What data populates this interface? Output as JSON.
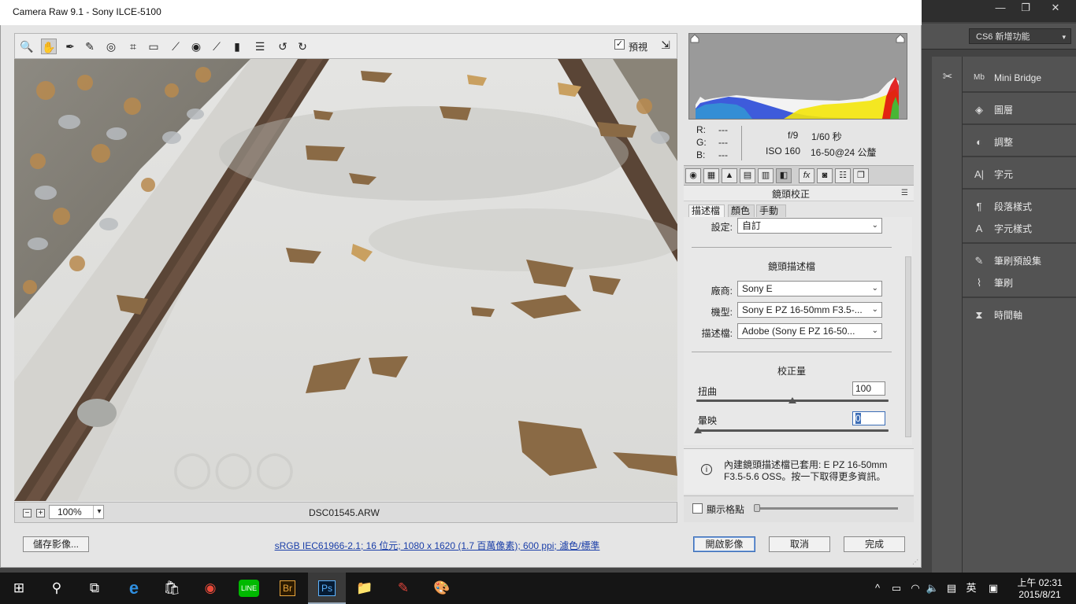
{
  "window": {
    "title": "Camera Raw 9.1  -  Sony ILCE-5100"
  },
  "photoshop": {
    "workspace": "CS6 新增功能",
    "window_controls": [
      "—",
      "❐",
      "✕"
    ],
    "panels": [
      {
        "icon": "Mb",
        "label": "Mini Bridge"
      },
      {
        "icon": "◈",
        "label": "圖層"
      },
      {
        "icon": "◐",
        "label": "調整"
      },
      {
        "icon": "A|",
        "label": "字元"
      },
      {
        "icon": "¶",
        "label": "段落樣式"
      },
      {
        "icon": "A",
        "label": "字元樣式"
      },
      {
        "icon": "✎",
        "label": "筆刷預設集"
      },
      {
        "icon": "⌇",
        "label": "筆刷"
      },
      {
        "icon": "⧗",
        "label": "時間軸"
      }
    ]
  },
  "toolbar": {
    "tools": [
      {
        "name": "zoom-tool",
        "glyph": "🔍"
      },
      {
        "name": "hand-tool",
        "glyph": "✋"
      },
      {
        "name": "white-balance-tool",
        "glyph": "✒"
      },
      {
        "name": "color-sampler-tool",
        "glyph": "✎"
      },
      {
        "name": "targeted-adjustment-tool",
        "glyph": "◎"
      },
      {
        "name": "crop-tool",
        "glyph": "⌗"
      },
      {
        "name": "straighten-tool",
        "glyph": "▭"
      },
      {
        "name": "spot-removal-tool",
        "glyph": "⟋"
      },
      {
        "name": "red-eye-tool",
        "glyph": "◉"
      },
      {
        "name": "adjustment-brush",
        "glyph": "⟋"
      },
      {
        "name": "graduated-filter",
        "glyph": "▮"
      },
      {
        "name": "preferences",
        "glyph": "☰"
      },
      {
        "name": "rotate-left",
        "glyph": "↺"
      },
      {
        "name": "rotate-right",
        "glyph": "↻"
      }
    ],
    "preview_label": "預視",
    "preview_checked": "✓"
  },
  "statusbar": {
    "zoom_minus": "−",
    "zoom_plus": "+",
    "zoom": "100%",
    "filename": "DSC01545.ARW"
  },
  "info": {
    "r_label": "R:",
    "r_val": "---",
    "g_label": "G:",
    "g_val": "---",
    "b_label": "B:",
    "b_val": "---",
    "aperture": "f/9",
    "shutter": "1/60 秒",
    "iso": "ISO 160",
    "lens": "16-50@24 公釐"
  },
  "panel_tabs": [
    "◉",
    "▦",
    "▲",
    "▤",
    "▥",
    "◧",
    "fx",
    "◙",
    "☷",
    "❒"
  ],
  "lens_panel": {
    "title": "鏡頭校正",
    "menu": "☰",
    "subtabs": [
      "描述檔",
      "顏色",
      "手動"
    ],
    "setting_label": "設定:",
    "setting_value": "自訂",
    "profile_section": "鏡頭描述檔",
    "make_label": "廠商:",
    "make_value": "Sony E",
    "model_label": "機型:",
    "model_value": "Sony E PZ 16-50mm F3.5-...",
    "profile_label": "描述檔:",
    "profile_value": "Adobe (Sony E PZ 16-50...",
    "amount_section": "校正量",
    "distortion_label": "扭曲",
    "distortion_value": "100",
    "vignetting_label": "暈映",
    "vignetting_value": "0",
    "info_text": "內建鏡頭描述檔已套用: E PZ 16-50mm F3.5-5.6 OSS。按一下取得更多資訊。",
    "grid_label": "顯示格點"
  },
  "sliders": {
    "distortion": 0.5,
    "vignetting": 0.0
  },
  "bottom": {
    "save_label": "儲存影像...",
    "workflow": "sRGB IEC61966-2.1; 16 位元; 1080 x 1620 (1.7 百萬像素); 600 ppi; 濾色/標準",
    "open_label": "開啟影像",
    "cancel_label": "取消",
    "done_label": "完成"
  },
  "taskbar": {
    "apps": [
      "⊞",
      "⚲",
      "⧉",
      "e",
      "🛍",
      "◉",
      "LINE",
      "Br",
      "Ps",
      "📁",
      "✎",
      "🎨"
    ],
    "tray": [
      "^",
      "▭",
      "◠",
      "🔈",
      "▤",
      "英",
      "▣"
    ],
    "time": "上午 02:31",
    "date": "2015/8/21"
  }
}
